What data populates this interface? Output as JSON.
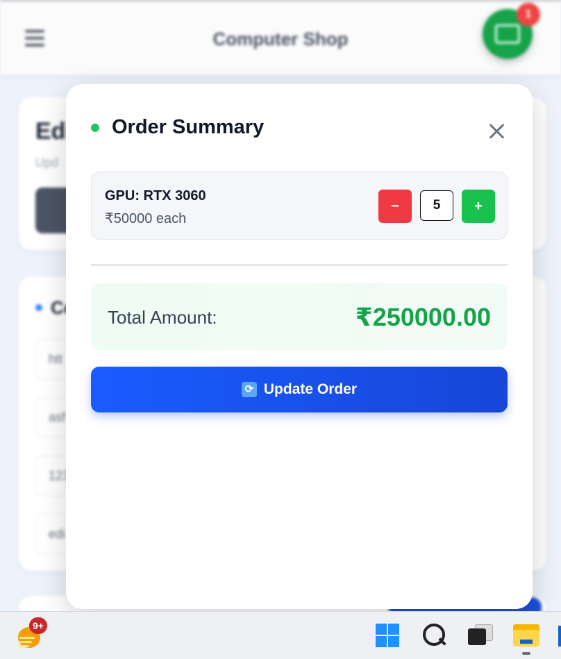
{
  "app": {
    "title": "Computer Shop",
    "cart_badge": "1"
  },
  "background": {
    "card1_heading": "Edi",
    "card1_sub": "Upd",
    "card2_heading": "Co",
    "fields": [
      "htt",
      "asf",
      "123",
      "edi"
    ]
  },
  "modal": {
    "title": "Order Summary",
    "item": {
      "name": "GPU: RTX 3060",
      "price": "₹50000 each",
      "quantity": "5",
      "minus_label": "−",
      "plus_label": "+"
    },
    "total_label": "Total Amount:",
    "total_value": "₹250000.00",
    "update_button": "Update Order",
    "update_icon": "🔄"
  },
  "taskbar": {
    "weather_badge": "9+"
  },
  "colors": {
    "accent_blue": "#1a5cff",
    "success_green": "#16a34a",
    "danger_red": "#ef3a43"
  }
}
